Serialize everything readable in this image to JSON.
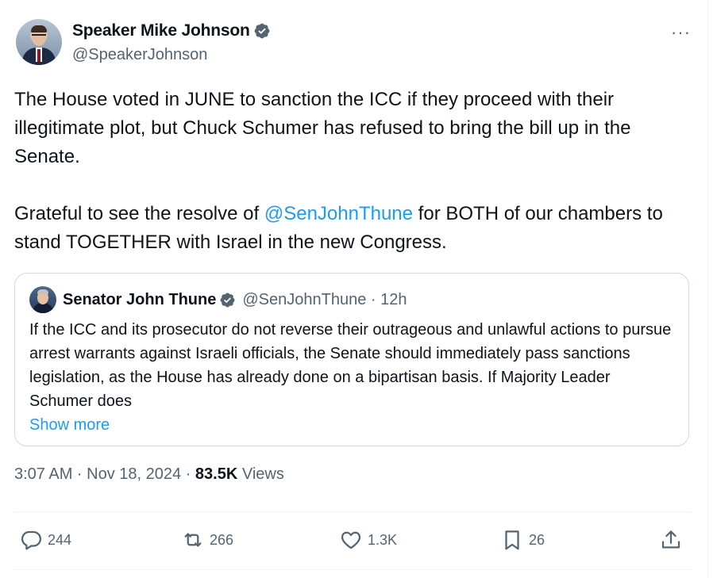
{
  "author": {
    "display_name": "Speaker Mike Johnson",
    "handle": "@SpeakerJohnson",
    "verified_icon": "verified-badge-icon"
  },
  "more_label": "···",
  "text": {
    "para1": "The House voted in JUNE to sanction the ICC if they proceed with their illegitimate plot, but Chuck Schumer has refused to bring the bill up in the Senate.",
    "para2_before": "Grateful to see the resolve of ",
    "para2_mention": "@SenJohnThune",
    "para2_after": " for BOTH of our chambers to stand TOGETHER with Israel in the new Congress."
  },
  "quote": {
    "display_name": "Senator John Thune",
    "handle_time": "@SenJohnThune · 12h",
    "text": "If the ICC and its prosecutor do not reverse their outrageous and unlawful actions to pursue arrest warrants against Israeli officials, the Senate should immediately pass sanctions legislation, as the House has already done on a bipartisan basis. If Majority Leader Schumer does",
    "show_more": "Show more"
  },
  "meta": {
    "time_date": "3:07 AM · Nov 18, 2024 · ",
    "views_count": "83.5K",
    "views_label": " Views"
  },
  "actions": {
    "replies": "244",
    "reposts": "266",
    "likes": "1.3K",
    "bookmarks": "26"
  },
  "colors": {
    "accent": "#1d9bf0",
    "secondary_text": "#536471",
    "border": "#cfd9de"
  }
}
